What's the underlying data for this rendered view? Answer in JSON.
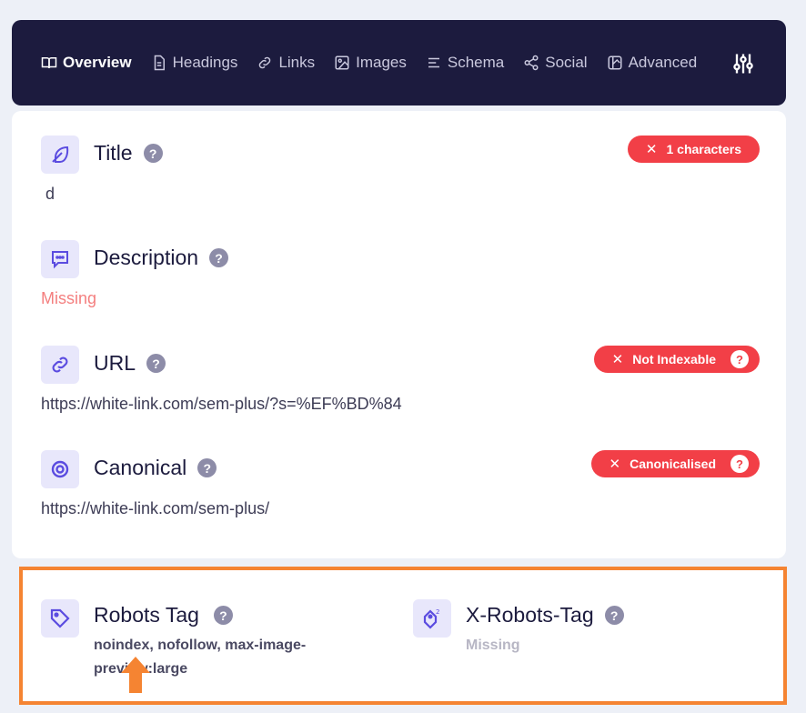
{
  "nav": {
    "tabs": [
      {
        "label": "Overview",
        "icon": "book-icon",
        "active": true
      },
      {
        "label": "Headings",
        "icon": "document-icon",
        "active": false
      },
      {
        "label": "Links",
        "icon": "link-icon",
        "active": false
      },
      {
        "label": "Images",
        "icon": "image-icon",
        "active": false
      },
      {
        "label": "Schema",
        "icon": "lines-icon",
        "active": false
      },
      {
        "label": "Social",
        "icon": "share-icon",
        "active": false
      },
      {
        "label": "Advanced",
        "icon": "advanced-icon",
        "active": false
      }
    ],
    "settings_icon": "sliders-icon"
  },
  "overview": {
    "title": {
      "label": "Title",
      "value": "d",
      "badge": "1 characters"
    },
    "description": {
      "label": "Description",
      "value": "Missing"
    },
    "url": {
      "label": "URL",
      "value": "https://white-link.com/sem-plus/?s=%EF%BD%84",
      "badge": "Not Indexable"
    },
    "canonical": {
      "label": "Canonical",
      "value": "https://white-link.com/sem-plus/",
      "badge": "Canonicalised"
    }
  },
  "robots": {
    "robots_tag": {
      "label": "Robots Tag",
      "value": "noindex, nofollow, max-image-preview:large"
    },
    "x_robots_tag": {
      "label": "X-Robots-Tag",
      "value": "Missing"
    }
  },
  "colors": {
    "nav_bg": "#1c1b3e",
    "badge_red": "#f23f47",
    "accent_purple": "#5b4ce0",
    "highlight_orange": "#f58432"
  }
}
